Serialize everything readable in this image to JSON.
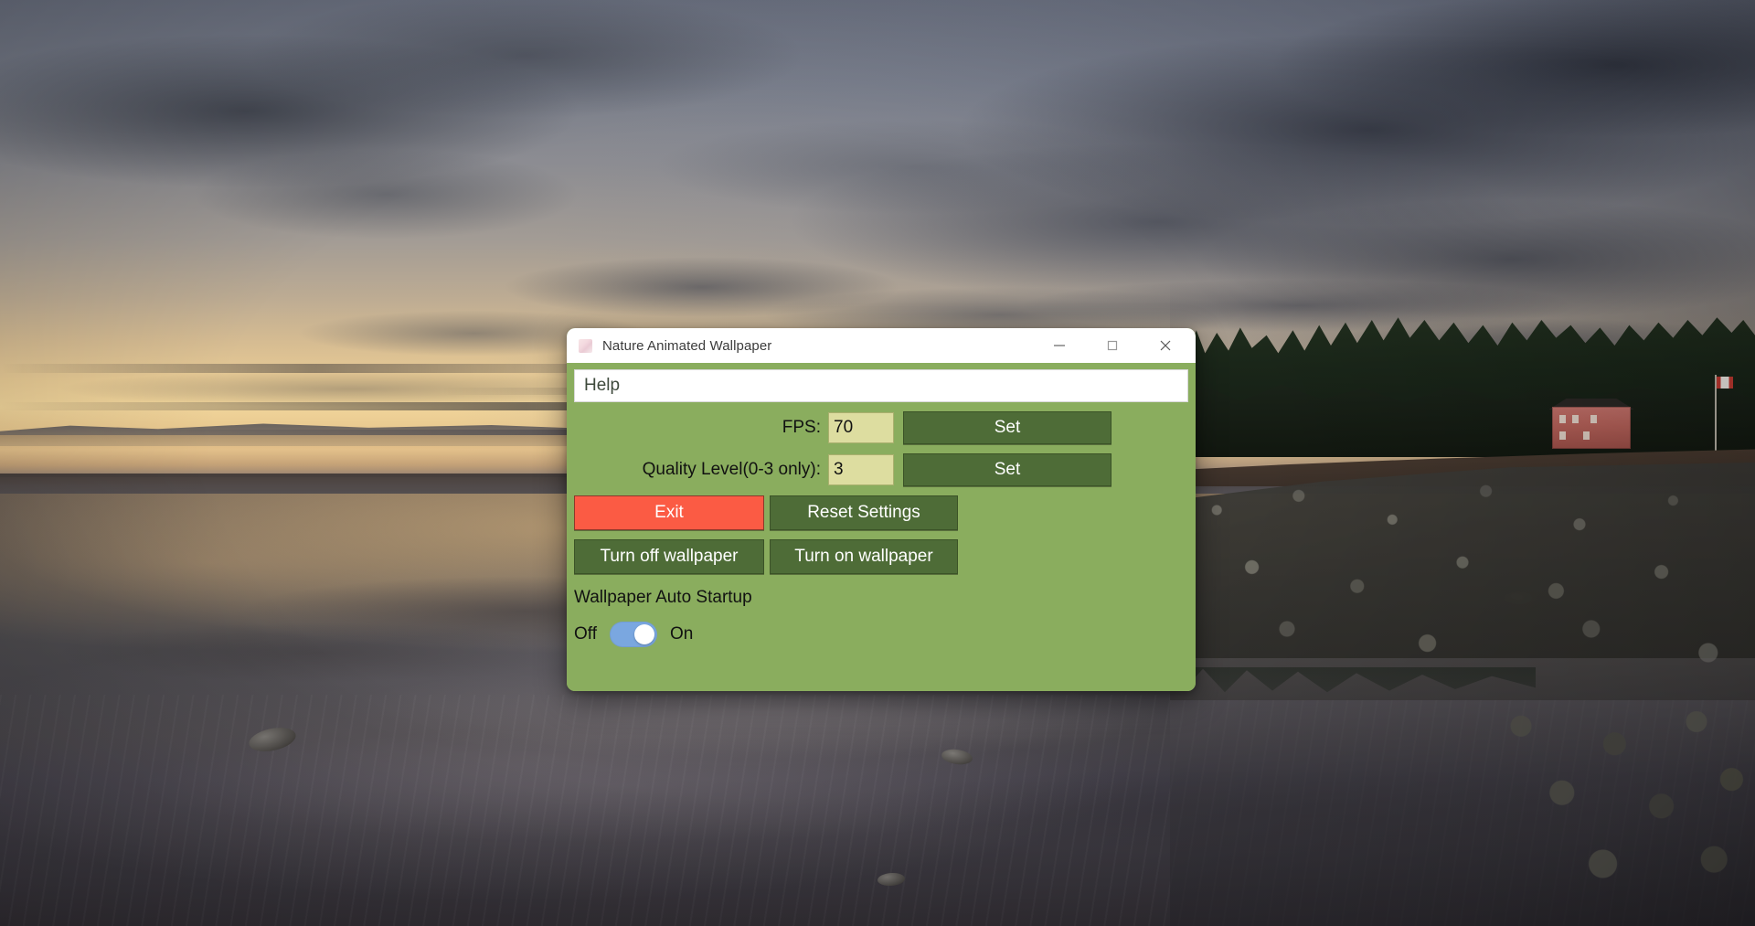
{
  "desktop": {
    "wallpaper_description": "Sunset beach with dramatic clouds, tidal flats reflecting golden sky, rocky shoreline and treeline with pink house"
  },
  "window": {
    "title": "Nature Animated Wallpaper",
    "icon": "app-icon",
    "controls": {
      "minimize": "minimize-icon",
      "maximize": "maximize-icon",
      "close": "close-icon"
    }
  },
  "help_bar": {
    "text": "Help"
  },
  "fps_row": {
    "label": "FPS:",
    "value": "70",
    "button": "Set"
  },
  "quality_row": {
    "label": "Quality Level(0-3 only):",
    "value": "3",
    "button": "Set"
  },
  "actions": {
    "exit": "Exit",
    "reset": "Reset Settings",
    "turn_off": "Turn off wallpaper",
    "turn_on": "Turn on wallpaper"
  },
  "autostart": {
    "section_label": "Wallpaper Auto Startup",
    "off_label": "Off",
    "on_label": "On",
    "state": "on"
  },
  "colors": {
    "panel_green": "#8aad5e",
    "button_green": "#4e6c37",
    "exit_red": "#fb5b44",
    "input_yellow": "#ddddA0",
    "toggle_blue": "#7aa7e0"
  }
}
